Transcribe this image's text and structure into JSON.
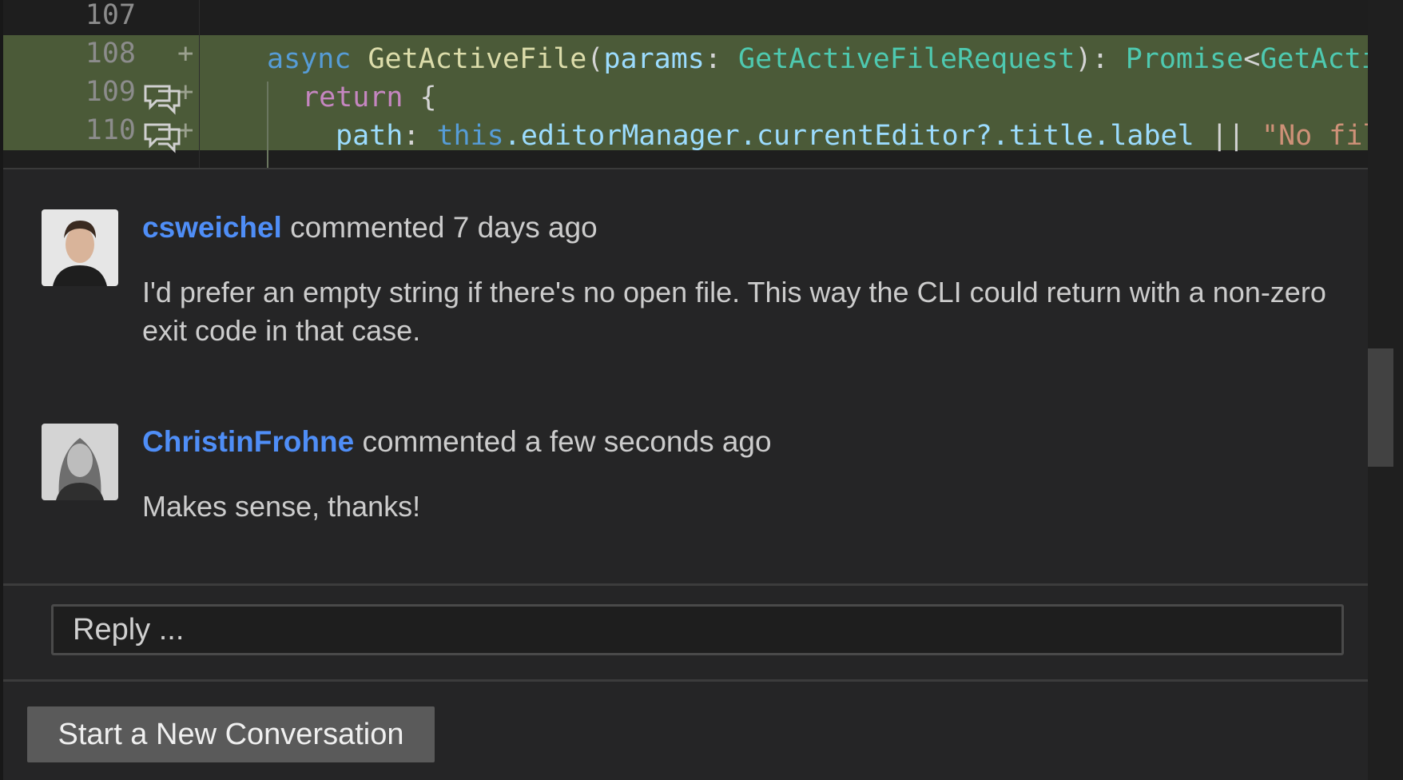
{
  "diff": {
    "lines": [
      {
        "number": "107",
        "added": false,
        "has_comment": false
      },
      {
        "number": "108",
        "added": true,
        "has_comment": false
      },
      {
        "number": "109",
        "added": true,
        "has_comment": true
      },
      {
        "number": "110",
        "added": true,
        "has_comment": true
      }
    ],
    "code": {
      "line108": {
        "kw": "async",
        "fn": "GetActiveFile",
        "paren_open": "(",
        "param": "params",
        "colon": ": ",
        "type": "GetActiveFileRequest",
        "close": "): ",
        "ret_type": "Promise",
        "lt": "<",
        "ret_type2": "GetActi"
      },
      "line109": {
        "kw": "return",
        "brace": " {"
      },
      "line110": {
        "prop": "path",
        "colon": ": ",
        "this": "this",
        "chain": ".editorManager.currentEditor?.title.label",
        "op": " || ",
        "str": "\"No fil"
      }
    },
    "plus_sign": "+"
  },
  "comments": [
    {
      "author": "csweichel",
      "action": " commented 7 days ago",
      "body": "I'd prefer an empty string if there's no open file. This way the CLI could return with a non-zero exit code in that case."
    },
    {
      "author": "ChristinFrohne",
      "action": " commented a few seconds ago",
      "body": "Makes sense, thanks!"
    }
  ],
  "reply": {
    "placeholder": "Reply ..."
  },
  "actions": {
    "new_conversation": "Start a New Conversation"
  },
  "colors": {
    "added_bg": "#4b5a38",
    "author_link": "#4f8ef7",
    "panel_bg": "#252526"
  }
}
